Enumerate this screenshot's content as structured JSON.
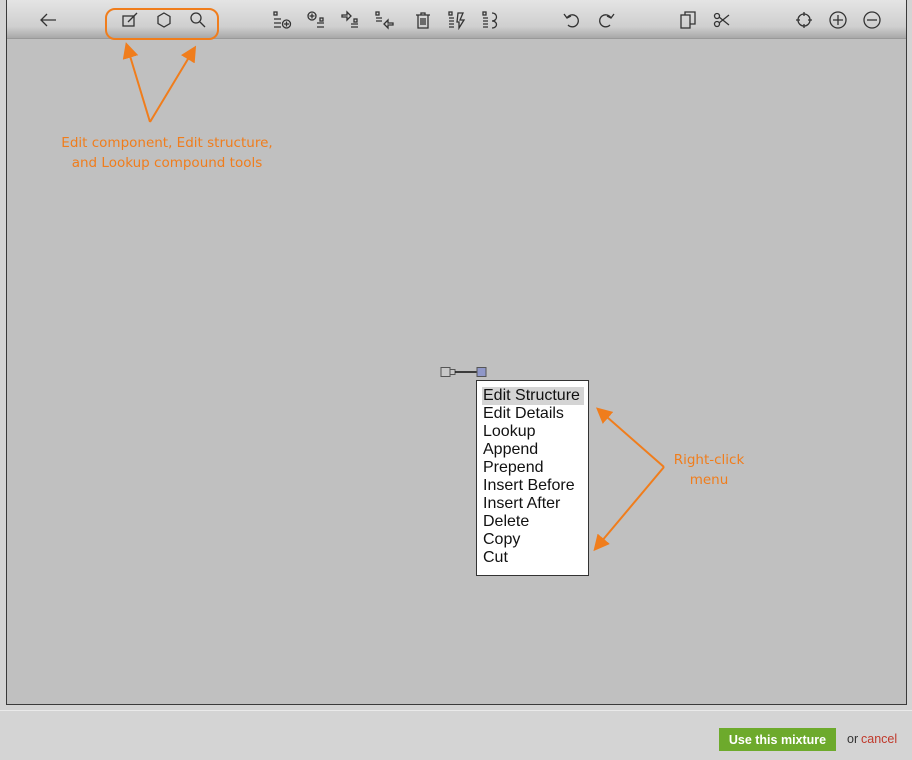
{
  "toolbar": {
    "buttons": [
      {
        "name": "back-arrow-icon"
      },
      {
        "name": "edit-component-icon"
      },
      {
        "name": "edit-structure-icon"
      },
      {
        "name": "lookup-compound-icon"
      },
      {
        "name": "append-icon"
      },
      {
        "name": "prepend-icon"
      },
      {
        "name": "insert-before-icon"
      },
      {
        "name": "insert-after-icon"
      },
      {
        "name": "delete-icon"
      },
      {
        "name": "copy-structure-icon"
      },
      {
        "name": "paste-structure-icon"
      },
      {
        "name": "undo-icon"
      },
      {
        "name": "redo-icon"
      },
      {
        "name": "copy-icon"
      },
      {
        "name": "cut-icon"
      },
      {
        "name": "center-icon"
      },
      {
        "name": "zoom-in-icon"
      },
      {
        "name": "zoom-out-icon"
      }
    ],
    "highlight_color": "#f07d1c"
  },
  "annotations": {
    "tools_line1": "Edit component, Edit structure,",
    "tools_line2": "and Lookup compound tools",
    "menu_line1": "Right-click",
    "menu_line2": "menu",
    "color": "#f07d1c"
  },
  "context_menu": {
    "items": [
      "Edit Structure",
      "Edit Details",
      "Lookup",
      "Append",
      "Prepend",
      "Insert Before",
      "Insert After",
      "Delete",
      "Copy",
      "Cut"
    ],
    "selected": "Edit Structure"
  },
  "footer": {
    "use_button": "Use this mixture",
    "or_text": "or",
    "cancel": "cancel",
    "accent": "#6daa2c"
  }
}
